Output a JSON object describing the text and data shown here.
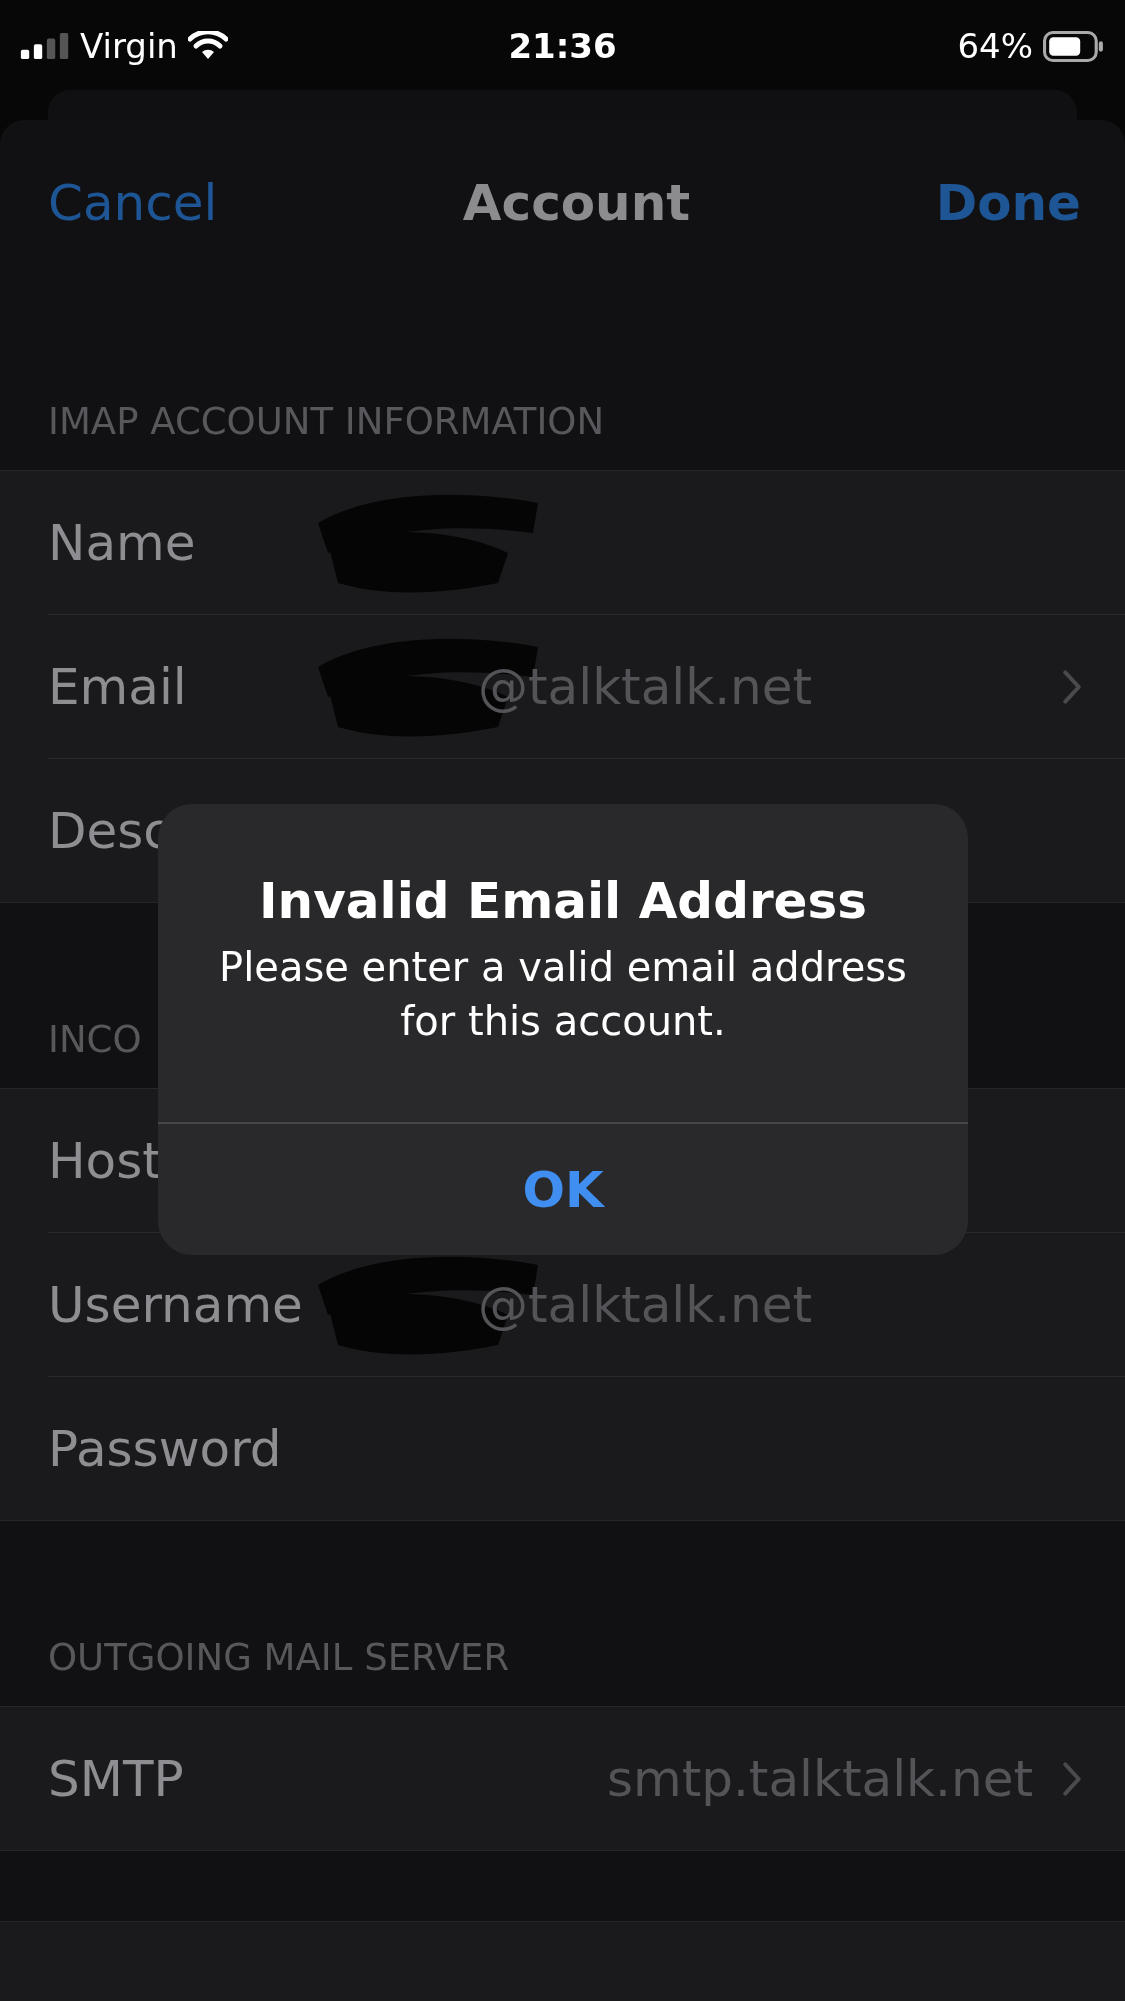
{
  "status_bar": {
    "carrier": "Virgin",
    "time": "21:36",
    "battery": "64%"
  },
  "nav": {
    "cancel": "Cancel",
    "title": "Account",
    "done": "Done"
  },
  "sections": [
    {
      "header": "IMAP ACCOUNT INFORMATION",
      "rows": [
        {
          "kind": "text",
          "label": "Name",
          "value": "",
          "redacted": true
        },
        {
          "kind": "link",
          "label": "Email",
          "value": "@talktalk.net",
          "redacted": true
        },
        {
          "kind": "text",
          "label": "Desc",
          "value": "",
          "redacted": false
        }
      ]
    },
    {
      "header": "INCO",
      "rows": [
        {
          "kind": "text",
          "label": "Host",
          "value": "",
          "redacted": false
        },
        {
          "kind": "text",
          "label": "Username",
          "value": "@talktalk.net",
          "redacted": true
        },
        {
          "kind": "text",
          "label": "Password",
          "value": "",
          "redacted": false
        }
      ]
    },
    {
      "header": "OUTGOING MAIL SERVER",
      "rows": [
        {
          "kind": "link",
          "label": "SMTP",
          "value": "smtp.talktalk.net",
          "redacted": false
        }
      ]
    }
  ],
  "alert": {
    "title": "Invalid Email Address",
    "message": "Please enter a valid email address for this account.",
    "button": "OK"
  }
}
